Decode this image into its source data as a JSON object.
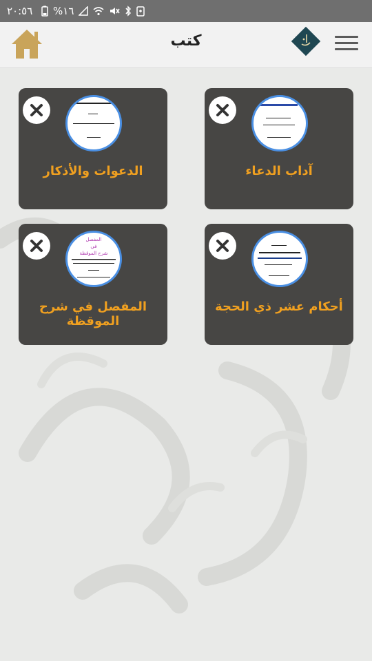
{
  "status_bar": {
    "time": "٢٠:٥٦",
    "battery": "%١٦"
  },
  "header": {
    "title": "كتب"
  },
  "books": [
    {
      "title": "آداب الدعاء"
    },
    {
      "title": "الدعوات والأذكار"
    },
    {
      "title": "أحكام عشر ذي الحجة"
    },
    {
      "title": "المفصل في شرح الموقظة"
    }
  ],
  "cover_text": {
    "book_1": "المفصل في شرح الموقظة",
    "book_1_heading": "المفصل",
    "book_1_sub": "في",
    "book_1_line": "شرح الموقظة"
  },
  "colors": {
    "card_bg": "#474644",
    "title_accent": "#f0a020",
    "cover_ring": "#4a8fe3",
    "home_icon": "#c9a45a"
  },
  "icons": [
    "home-icon",
    "logo-icon",
    "menu-icon",
    "close-icon"
  ]
}
